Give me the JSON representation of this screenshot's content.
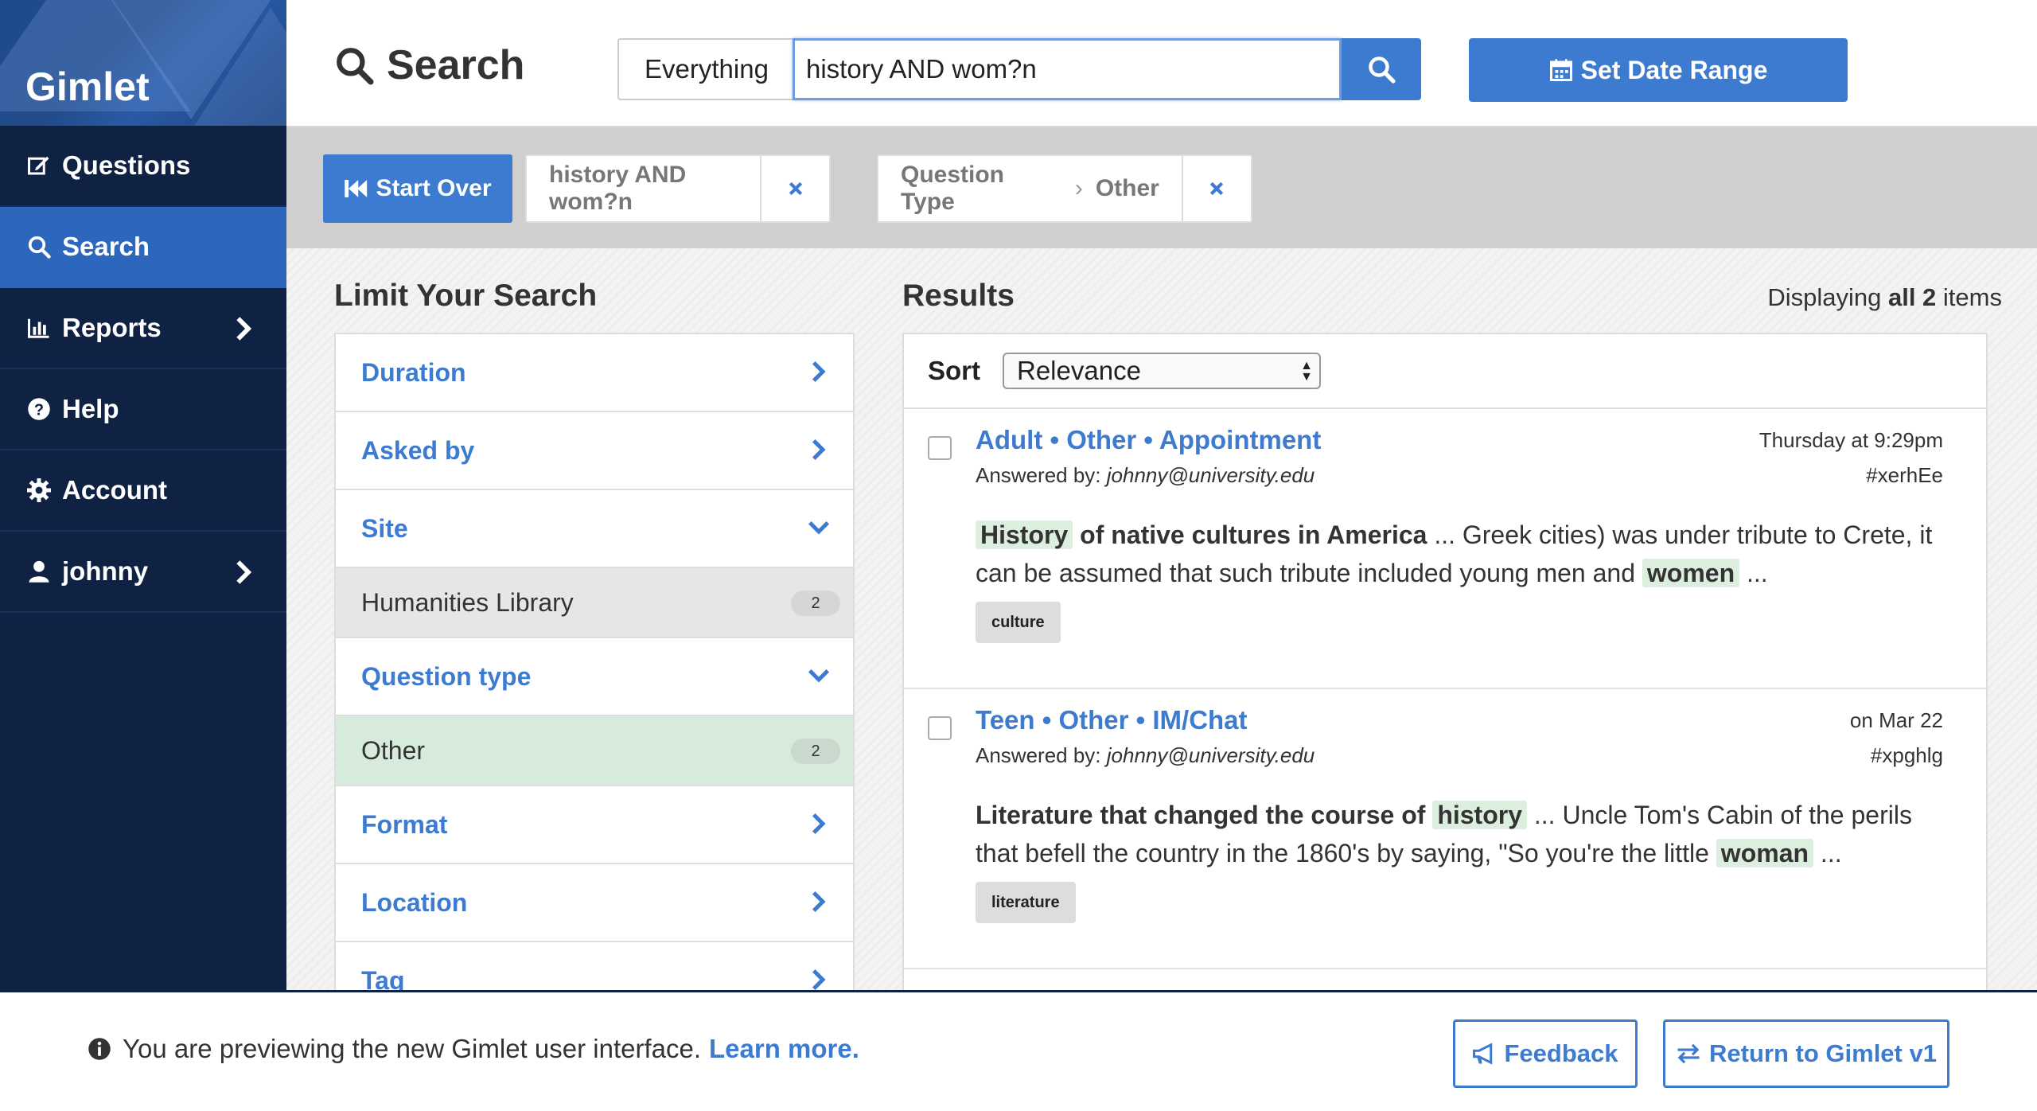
{
  "brand": {
    "name": "Gimlet"
  },
  "sidebar": {
    "items": [
      {
        "label": "Questions",
        "icon": "edit-icon"
      },
      {
        "label": "Search",
        "icon": "search-icon"
      },
      {
        "label": "Reports",
        "icon": "bar-chart-icon"
      },
      {
        "label": "Help",
        "icon": "question-circle-icon"
      },
      {
        "label": "Account",
        "icon": "gear-icon"
      },
      {
        "label": "johnny",
        "icon": "user-icon"
      }
    ],
    "active": "Search"
  },
  "header": {
    "title": "Search",
    "scope": "Everything",
    "query": "history AND wom?n",
    "date_button": "Set Date Range"
  },
  "filters": {
    "start_over": "Start Over",
    "chips": [
      {
        "text": "history AND wom?n"
      },
      {
        "field": "Question Type",
        "value": "Other"
      }
    ]
  },
  "limit": {
    "title": "Limit Your Search",
    "facets": [
      {
        "label": "Duration"
      },
      {
        "label": "Asked by"
      },
      {
        "label": "Site",
        "option": {
          "label": "Humanities Library",
          "count": "2"
        }
      },
      {
        "label": "Question type",
        "option": {
          "label": "Other",
          "count": "2"
        }
      },
      {
        "label": "Format"
      },
      {
        "label": "Location"
      },
      {
        "label": "Tag"
      }
    ]
  },
  "results": {
    "title": "Results",
    "display_prefix": "Displaying",
    "display_count": "all 2",
    "display_suffix": "items",
    "sort_label": "Sort",
    "sort_value": "Relevance",
    "items": [
      {
        "title": "Adult • Other • Appointment",
        "answered_label": "Answered by:",
        "answered_by": "johnny@university.edu",
        "time": "Thursday at 9:29pm",
        "id": "#xerhEe",
        "snippet_hl1": "History",
        "snippet_bold": "of native cultures in America",
        "snippet_text1": "... Greek cities) was under tribute to Crete, it can be assumed that such tribute included young men and",
        "snippet_hl2": "women",
        "snippet_text2": "...",
        "tag": "culture"
      },
      {
        "title": "Teen • Other • IM/Chat",
        "answered_label": "Answered by:",
        "answered_by": "johnny@university.edu",
        "time": "on Mar 22",
        "id": "#xpghlg",
        "snippet_bold": "Literature that changed the course of",
        "snippet_hl1": "history",
        "snippet_text1": "... Uncle Tom's Cabin of the perils that befell the country in the 1860's by saying, \"So you're the little",
        "snippet_hl2": "woman",
        "snippet_text2": "...",
        "tag": "literature"
      }
    ]
  },
  "footer": {
    "notice": "You are previewing the new Gimlet user interface.",
    "learn_more": "Learn more.",
    "feedback": "Feedback",
    "return": "Return to Gimlet v1"
  },
  "colors": {
    "sidebar": "#0f2244",
    "accent": "#3d7bd0",
    "highlight": "#dcefdf"
  }
}
